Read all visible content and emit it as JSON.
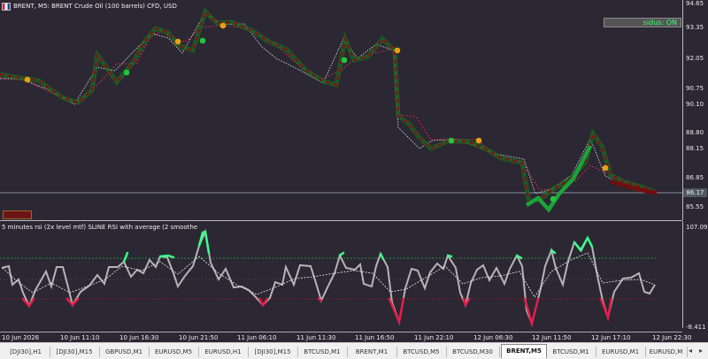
{
  "title": "BRENT, M5:  BRENT Crude Oil (100 barrels) CFD, USD",
  "signal_box": "sidus: ON",
  "mini_box": "",
  "price_axis": [
    "94.65",
    "93.35",
    "92.05",
    "90.75",
    "90.10",
    "88.80",
    "88.15",
    "86.85",
    "86.17",
    "85.55"
  ],
  "current_price": "86.17",
  "osc_title": "5 minutes rsi (2x level mtf) SLINE RSI  with average (2 smoothe",
  "osc_axis": [
    "107.092",
    "-8.411"
  ],
  "time_axis": [
    "10 Jun 2026",
    "10 Jun 11:10",
    "10 Jun 16:30",
    "10 Jun 21:50",
    "11 Jun 06:10",
    "11 Jun 11:30",
    "11 Jun 16:50",
    "11 Jun 22:10",
    "12 Jun 06:30",
    "12 Jun 11:50",
    "12 Jun 17:10",
    "12 Jun 22:30"
  ],
  "tabs": [
    "[DJI30],H1",
    "[DJI30],M15",
    "GBPUSD,M1",
    "EURUSD,M5",
    "EURUSD,H1",
    "[DJI30],M15",
    "BTCUSD,M1",
    "BRENT,M1",
    "BTCUSD,M5",
    "BTCUSD,M30",
    "BRENT,M5",
    "BTCUSD,M1",
    "EURUSD,M1",
    "EURUSD,M"
  ],
  "active_tab": 10,
  "colors": {
    "bull": "#139022",
    "bear": "#7d1616",
    "dot_up": "#22c63b",
    "dot_down": "#e8a00e",
    "osc_high": "#39ff8a",
    "osc_low": "#e51d4a",
    "osc_mid": "#b5b5b5"
  }
}
